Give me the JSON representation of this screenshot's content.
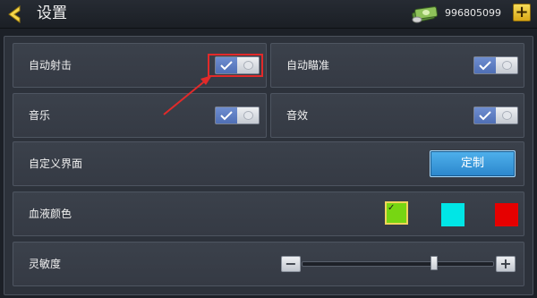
{
  "header": {
    "title": "设置",
    "money": "996805099",
    "back_icon": "back-arrow-icon",
    "money_icon": "cash-stack-icon",
    "plus_icon": "plus-icon"
  },
  "settings": {
    "auto_fire": {
      "label": "自动射击",
      "enabled": true
    },
    "auto_aim": {
      "label": "自动瞄准",
      "enabled": true
    },
    "music": {
      "label": "音乐",
      "enabled": true
    },
    "sound_effects": {
      "label": "音效",
      "enabled": true
    },
    "custom_ui": {
      "label": "自定义界面",
      "button_label": "定制"
    },
    "blood_color": {
      "label": "血液颜色",
      "options": [
        "#77d612",
        "#00e6e6",
        "#e60000"
      ],
      "selected_index": 0
    },
    "sensitivity": {
      "label": "灵敏度",
      "minus": "−",
      "plus": "+",
      "value_fraction": 0.69
    }
  },
  "colors": {
    "toggle_on": "#5876bd",
    "button_blue": "#3b9be0",
    "highlight": "#e22a2a"
  }
}
